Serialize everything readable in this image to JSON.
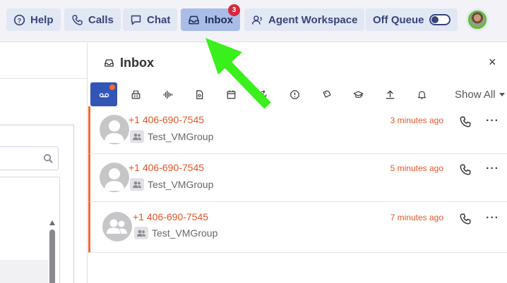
{
  "topbar": {
    "help_label": "Help",
    "calls_label": "Calls",
    "chat_label": "Chat",
    "inbox_label": "Inbox",
    "inbox_badge": "3",
    "workspace_label": "Agent Workspace",
    "queue_label": "Off Queue",
    "queue_on": false,
    "active_color": "#a9bde6",
    "badge_color": "#d6293d"
  },
  "inbox_panel": {
    "title": "Inbox",
    "close_glyph": "×",
    "filter_icons": [
      "voicemail-icon",
      "fax-icon",
      "recording-icon",
      "document-icon",
      "calendar-icon",
      "callback-icon",
      "alert-icon",
      "tag-icon",
      "training-icon",
      "upload-icon",
      "bell-icon"
    ],
    "filter_active": "voicemail-icon",
    "show_all_label": "Show All",
    "items": [
      {
        "phone": "+1 406-690-7545",
        "group": "Test_VMGroup",
        "time": "3 minutes ago",
        "avatar": "person-avatar"
      },
      {
        "phone": "+1 406-690-7545",
        "group": "Test_VMGroup",
        "time": "5 minutes ago",
        "avatar": "person-avatar"
      },
      {
        "phone": "+1 406-690-7545",
        "group": "Test_VMGroup",
        "time": "7 minutes ago",
        "avatar": "group-avatar"
      }
    ],
    "accent_color": "#f26a34",
    "more_glyph": "···"
  }
}
